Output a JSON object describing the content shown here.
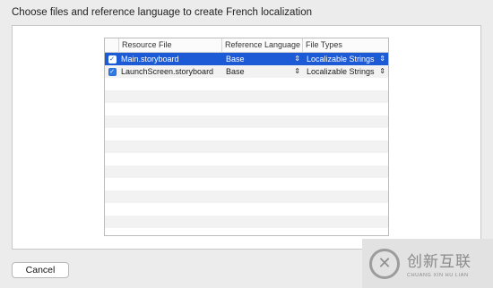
{
  "dialog": {
    "heading": "Choose files and reference language to create French localization",
    "cancel_label": "Cancel"
  },
  "table": {
    "headers": {
      "select": "",
      "resource_file": "Resource File",
      "reference_language": "Reference Language",
      "file_types": "File Types"
    },
    "rows": [
      {
        "checked": true,
        "selected": true,
        "resource_file": "Main.storyboard",
        "reference_language": "Base",
        "file_type": "Localizable Strings"
      },
      {
        "checked": true,
        "selected": false,
        "resource_file": "LaunchScreen.storyboard",
        "reference_language": "Base",
        "file_type": "Localizable Strings"
      }
    ],
    "empty_row_count": 12,
    "selection_color": "#1d5bd6",
    "checkbox_color": "#2f7ae5"
  },
  "icons": {
    "checkbox": "checkmark-icon",
    "stepper": "up-down-chevron-icon"
  },
  "watermark": {
    "chinese": "创新互联",
    "english": "CHUANG XIN HU LIAN",
    "logo_glyph": "✕"
  }
}
